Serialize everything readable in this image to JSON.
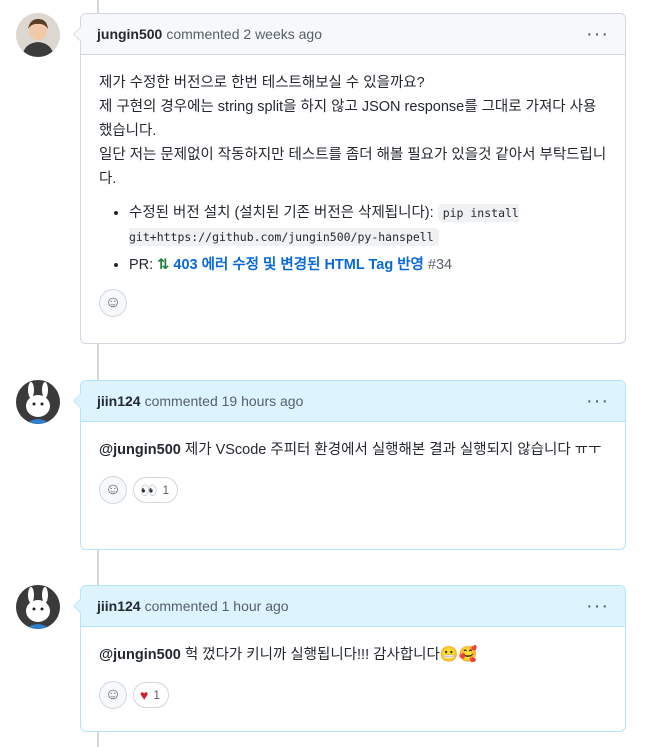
{
  "comments": [
    {
      "author": "jungin500",
      "meta": "commented 2 weeks ago",
      "highlight": false,
      "paragraphs": [
        "제가 수정한 버전으로 한번 테스트해보실 수 있을까요?",
        "제 구현의 경우에는 string split을 하지 않고 JSON response를 그대로 가져다 사용했습니다.",
        "일단 저는 문제없이 작동하지만 테스트를 좀더 해볼 필요가 있을것 같아서 부탁드립니다."
      ],
      "bullets": [
        {
          "label": "수정된 버전 설치 (설치된 기존 버전은 삭제됩니다):",
          "code": "pip install git+https://github.com/jungin500/py-hanspell"
        },
        {
          "label": "PR:",
          "pr_title": "403 에러 수정 및 변경된 HTML Tag 반영",
          "pr_number": "#34"
        }
      ],
      "reactions": []
    },
    {
      "author": "jiin124",
      "meta": "commented 19 hours ago",
      "highlight": true,
      "mention": "@jungin500",
      "text": "제가 VScode 주피터 환경에서 실행해본 결과 실행되지 않습니다 ㅠㅜ",
      "reactions": [
        {
          "emoji": "eyes-emoji",
          "count": "1"
        }
      ]
    },
    {
      "author": "jiin124",
      "meta": "commented 1 hour ago",
      "highlight": true,
      "mention": "@jungin500",
      "text": "헉 껐다가 키니까 실행됩니다!!! 감사합니다",
      "reactions": [
        {
          "emoji": "heart-emoji",
          "count": "1"
        }
      ]
    }
  ]
}
